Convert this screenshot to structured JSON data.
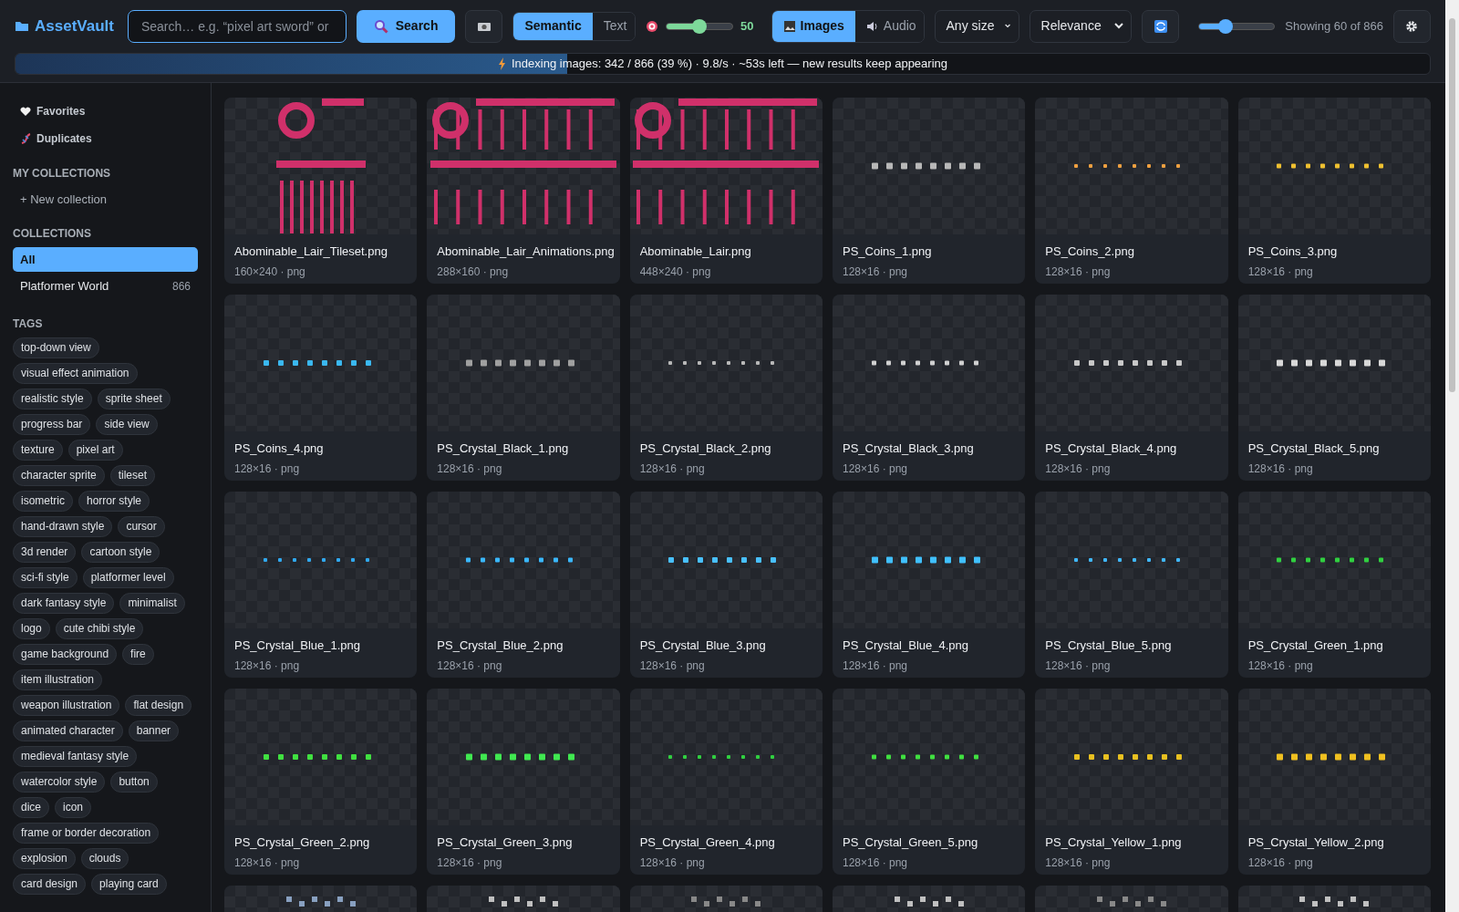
{
  "app": {
    "name": "AssetVault"
  },
  "search": {
    "placeholder": "Search… e.g. “pixel art sword” or",
    "button": "Search"
  },
  "mode_tabs": [
    {
      "label": "Semantic",
      "selected": true
    },
    {
      "label": "Text",
      "selected": false
    }
  ],
  "threshold": {
    "level": 0.5,
    "reading": "50"
  },
  "media_tabs": [
    {
      "label": "Images",
      "kind": "images",
      "selected": true
    },
    {
      "label": "Audio",
      "kind": "audio",
      "selected": false
    }
  ],
  "size_filter": {
    "value": "Any size"
  },
  "sort": {
    "value": "Relevance"
  },
  "thumb_size": {
    "level": 0.35
  },
  "result_count": "Showing 60 of 866",
  "indexing": {
    "level": 0.39,
    "text": "Indexing images: 342 / 866 (39 %) · 9.8/s · ~53s left — new results keep appearing"
  },
  "sidebar": {
    "nav": [
      {
        "label": "Favorites",
        "kind": "favorites"
      },
      {
        "label": "Duplicates",
        "kind": "duplicates"
      }
    ],
    "my_collections_heading": "MY COLLECTIONS",
    "new_collection": "+ New collection",
    "collections_heading": "COLLECTIONS",
    "collections": [
      {
        "label": "All",
        "selected": true
      },
      {
        "label": "Platformer World",
        "count": "866",
        "selected": false
      }
    ],
    "tags_heading": "TAGS",
    "tags": [
      "top-down view",
      "visual effect animation",
      "realistic style",
      "sprite sheet",
      "progress bar",
      "side view",
      "texture",
      "pixel art",
      "character sprite",
      "tileset",
      "isometric",
      "horror style",
      "hand-drawn style",
      "cursor",
      "3d render",
      "cartoon style",
      "sci-fi style",
      "platformer level",
      "dark fantasy style",
      "minimalist",
      "logo",
      "cute chibi style",
      "game background",
      "fire",
      "item illustration",
      "weapon illustration",
      "flat design",
      "animated character",
      "banner",
      "medieval fantasy style",
      "watercolor style",
      "button",
      "dice",
      "icon",
      "frame or border decoration",
      "explosion",
      "clouds",
      "card design",
      "playing card"
    ]
  },
  "assets": [
    {
      "name": "Abominable_Lair_Tileset.png",
      "meta": "160×240 · png"
    },
    {
      "name": "Abominable_Lair_Animations.png",
      "meta": "288×160 · png"
    },
    {
      "name": "Abominable_Lair.png",
      "meta": "448×240 · png"
    },
    {
      "name": "PS_Coins_1.png",
      "meta": "128×16 · png"
    },
    {
      "name": "PS_Coins_2.png",
      "meta": "128×16 · png"
    },
    {
      "name": "PS_Coins_3.png",
      "meta": "128×16 · png"
    },
    {
      "name": "PS_Coins_4.png",
      "meta": "128×16 · png"
    },
    {
      "name": "PS_Crystal_Black_1.png",
      "meta": "128×16 · png"
    },
    {
      "name": "PS_Crystal_Black_2.png",
      "meta": "128×16 · png"
    },
    {
      "name": "PS_Crystal_Black_3.png",
      "meta": "128×16 · png"
    },
    {
      "name": "PS_Crystal_Black_4.png",
      "meta": "128×16 · png"
    },
    {
      "name": "PS_Crystal_Black_5.png",
      "meta": "128×16 · png"
    },
    {
      "name": "PS_Crystal_Blue_1.png",
      "meta": "128×16 · png"
    },
    {
      "name": "PS_Crystal_Blue_2.png",
      "meta": "128×16 · png"
    },
    {
      "name": "PS_Crystal_Blue_3.png",
      "meta": "128×16 · png"
    },
    {
      "name": "PS_Crystal_Blue_4.png",
      "meta": "128×16 · png"
    },
    {
      "name": "PS_Crystal_Blue_5.png",
      "meta": "128×16 · png"
    },
    {
      "name": "PS_Crystal_Green_1.png",
      "meta": "128×16 · png"
    },
    {
      "name": "PS_Crystal_Green_2.png",
      "meta": "128×16 · png"
    },
    {
      "name": "PS_Crystal_Green_3.png",
      "meta": "128×16 · png"
    },
    {
      "name": "PS_Crystal_Green_4.png",
      "meta": "128×16 · png"
    },
    {
      "name": "PS_Crystal_Green_5.png",
      "meta": "128×16 · png"
    },
    {
      "name": "PS_Crystal_Yellow_1.png",
      "meta": "128×16 · png"
    },
    {
      "name": "PS_Crystal_Yellow_2.png",
      "meta": "128×16 · png"
    },
    {
      "kind": "picture"
    },
    {
      "kind": "picture"
    },
    {
      "kind": "picture"
    },
    {
      "kind": "picture"
    },
    {
      "kind": "picture"
    },
    {
      "kind": "picture"
    }
  ]
}
